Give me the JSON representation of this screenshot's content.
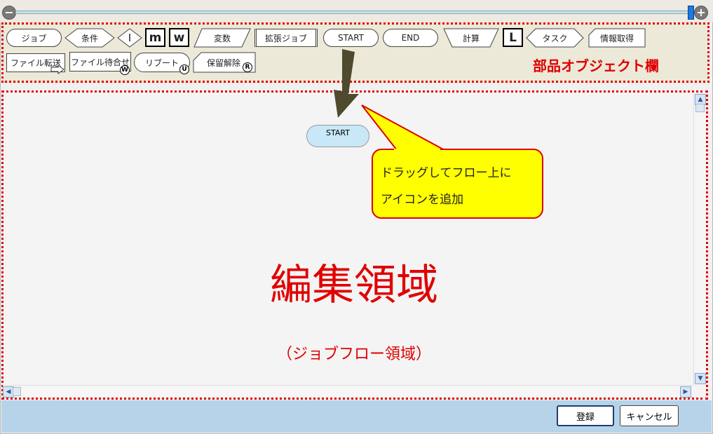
{
  "zoom": {
    "minus": "−",
    "plus": "+"
  },
  "palette": {
    "items": [
      "ジョブ",
      "条件",
      "I",
      "m",
      "w",
      "変数",
      "拡張ジョブ",
      "START",
      "END",
      "計算",
      "L",
      "タスク",
      "情報取得",
      "ファイル転送",
      "ファイル待合せ",
      "リブート",
      "保留解除"
    ],
    "marks": {
      "wait": "W",
      "reboot": "U",
      "release": "R"
    },
    "label": "部品オブジェクト欄"
  },
  "canvas": {
    "start_node": "START",
    "label": "編集領域",
    "sublabel": "（ジョブフロー領域）"
  },
  "callout": {
    "line1": "ドラッグしてフロー上に",
    "line2": "アイコンを追加"
  },
  "footer": {
    "register": "登録",
    "cancel": "キャンセル"
  },
  "colors": {
    "annotation": "#e00000",
    "callout_fill": "#ffff00",
    "start_fill": "#c9e8f7",
    "footer": "#b7d3e9",
    "arrow": "#4f4a2e"
  }
}
